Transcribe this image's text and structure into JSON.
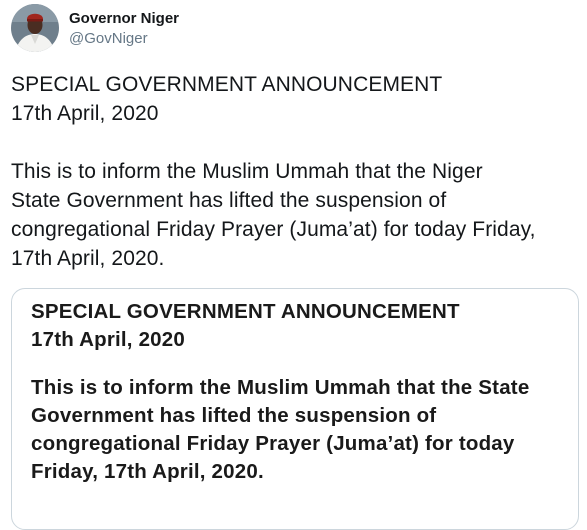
{
  "author": {
    "display_name": "Governor Niger",
    "handle": "@GovNiger",
    "avatar_icon": "user-avatar"
  },
  "tweet": {
    "title": "SPECIAL GOVERNMENT ANNOUNCEMENT",
    "date": "17th April, 2020",
    "body_lines": [
      "This is to inform the Muslim Ummah that the Niger",
      "State Government has lifted the suspension of",
      "congregational Friday Prayer (Juma’at) for today Friday,",
      "17th April, 2020."
    ]
  },
  "image": {
    "title": "SPECIAL GOVERNMENT ANNOUNCEMENT",
    "date": "17th April, 2020",
    "body_lines": [
      "This is to inform the Muslim Ummah that the State",
      "Government has lifted the suspension of",
      "congregational Friday Prayer (Juma’at) for today",
      "Friday, 17th April, 2020."
    ]
  },
  "colors": {
    "text": "#14171a",
    "secondary": "#657786",
    "border": "#ccd6dd"
  }
}
